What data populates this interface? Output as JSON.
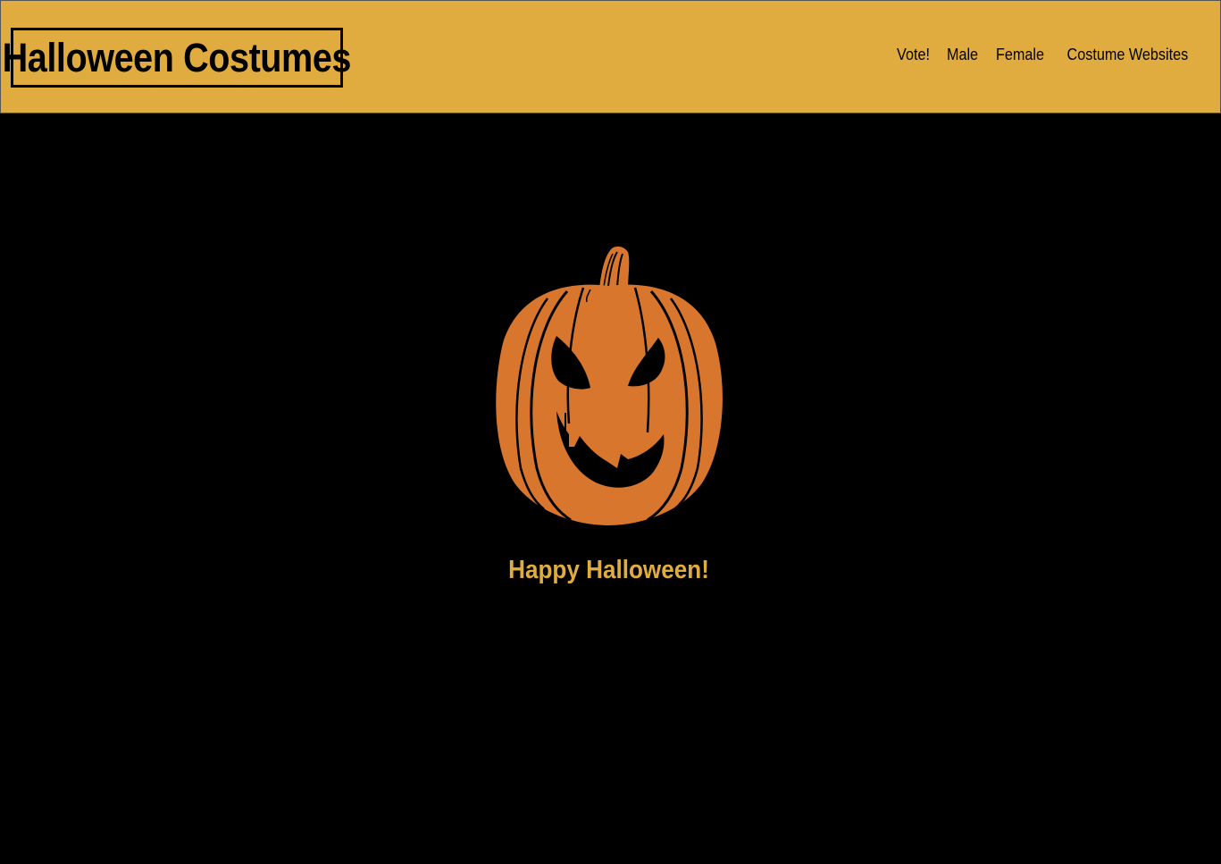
{
  "header": {
    "brand": "Halloween Costumes",
    "nav": [
      {
        "label": "Vote!"
      },
      {
        "label": "Male"
      },
      {
        "label": "Female"
      },
      {
        "label": "Costume Websites"
      }
    ]
  },
  "main": {
    "image_icon": "jack-o-lantern",
    "greeting": "Happy Halloween!"
  },
  "colors": {
    "header_bg": "#e1ac3f",
    "page_bg": "#000000",
    "pumpkin": "#d8762e",
    "greeting_text": "#e1ac3f"
  }
}
